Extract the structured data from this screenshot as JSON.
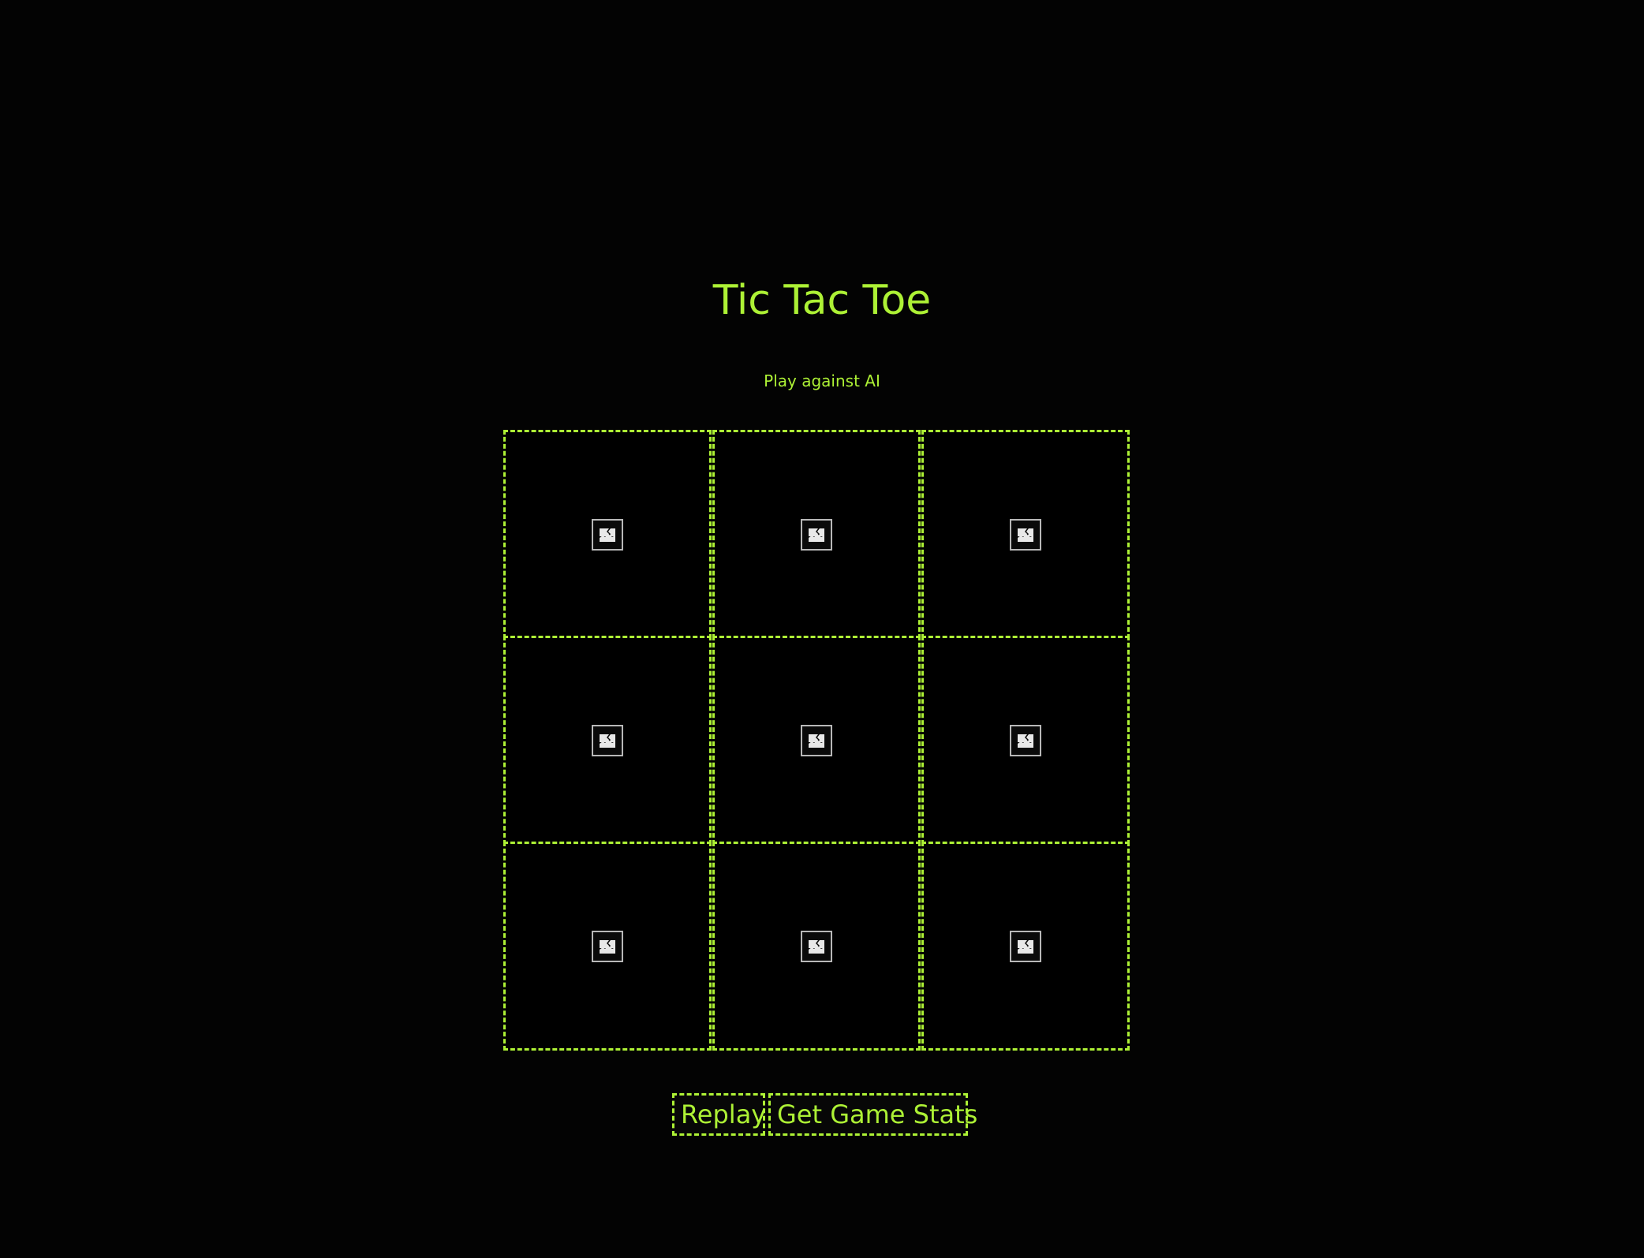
{
  "header": {
    "title": "Tic Tac Toe",
    "subtitle": "Play against AI"
  },
  "board": {
    "cells": [
      {
        "state": "",
        "icon": "broken-image-icon"
      },
      {
        "state": "",
        "icon": "broken-image-icon"
      },
      {
        "state": "",
        "icon": "broken-image-icon"
      },
      {
        "state": "",
        "icon": "broken-image-icon"
      },
      {
        "state": "",
        "icon": "broken-image-icon"
      },
      {
        "state": "",
        "icon": "broken-image-icon"
      },
      {
        "state": "",
        "icon": "broken-image-icon"
      },
      {
        "state": "",
        "icon": "broken-image-icon"
      },
      {
        "state": "",
        "icon": "broken-image-icon"
      }
    ]
  },
  "controls": {
    "replay_label": "Replay",
    "stats_label": "Get Game Stats"
  },
  "colors": {
    "accent": "#adf135",
    "background": "#030303"
  }
}
